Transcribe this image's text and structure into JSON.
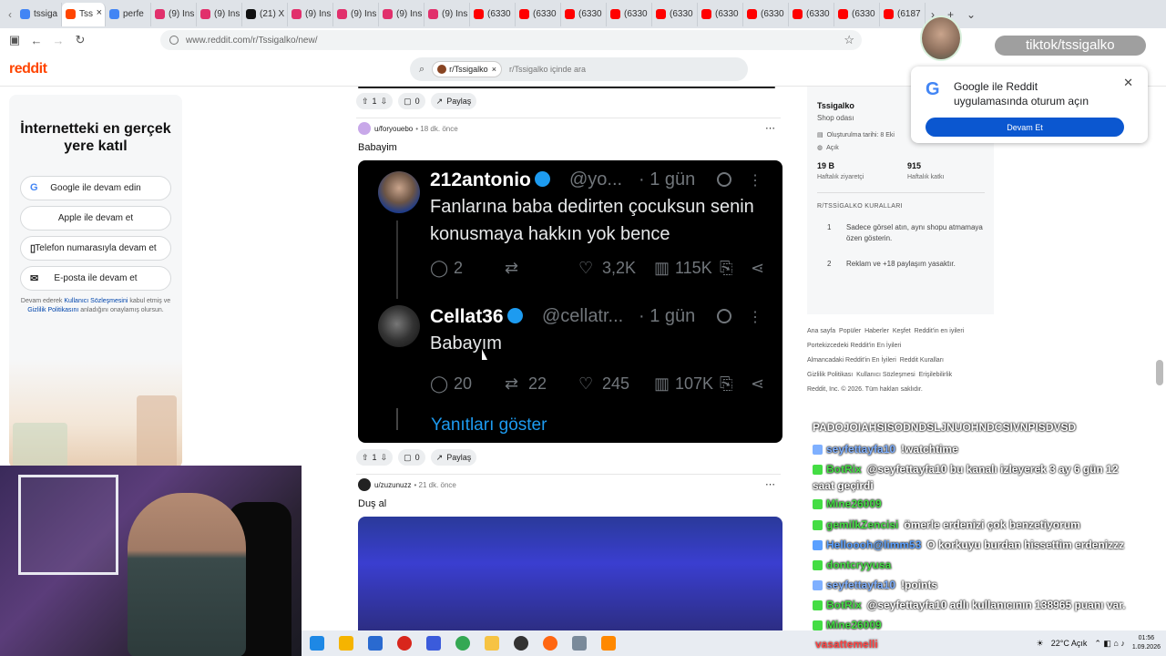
{
  "browser": {
    "tabs": [
      {
        "label": "tssiga",
        "color": "#4285f4"
      },
      {
        "label": "Tss",
        "color": "#ff4500",
        "active": true
      },
      {
        "label": "perfe",
        "color": "#4285f4"
      },
      {
        "label": "(9) Ins",
        "color": "#e1306c"
      },
      {
        "label": "(9) Ins",
        "color": "#e1306c"
      },
      {
        "label": "(21) X",
        "color": "#111111"
      },
      {
        "label": "(9) Ins",
        "color": "#e1306c"
      },
      {
        "label": "(9) Ins",
        "color": "#e1306c"
      },
      {
        "label": "(9) Ins",
        "color": "#e1306c"
      },
      {
        "label": "(9) Ins",
        "color": "#e1306c"
      },
      {
        "label": "(6330",
        "color": "#ff0000"
      },
      {
        "label": "(6330",
        "color": "#ff0000"
      },
      {
        "label": "(6330",
        "color": "#ff0000"
      },
      {
        "label": "(6330",
        "color": "#ff0000"
      },
      {
        "label": "(6330",
        "color": "#ff0000"
      },
      {
        "label": "(6330",
        "color": "#ff0000"
      },
      {
        "label": "(6330",
        "color": "#ff0000"
      },
      {
        "label": "(6330",
        "color": "#ff0000"
      },
      {
        "label": "(6330",
        "color": "#ff0000"
      },
      {
        "label": "(6187",
        "color": "#ff0000"
      }
    ],
    "url": "www.reddit.com/r/Tssigalko/new/"
  },
  "header": {
    "logo": "reddit",
    "search_chip": "r/Tssigalko",
    "search_placeholder": "r/Tssigalko içinde ara"
  },
  "login_panel": {
    "title": "İnternetteki en gerçek yere katıl",
    "buttons": [
      {
        "label": "Google ile devam edin",
        "icon": "G"
      },
      {
        "label": "Apple ile devam et",
        "icon": "apple"
      },
      {
        "label": "Telefon numarasıyla devam et",
        "icon": "phone"
      },
      {
        "label": "E-posta ile devam et",
        "icon": "mail"
      }
    ],
    "legal_pre": "Devam ederek ",
    "legal_link1": "Kullanıcı Sözleşmesini",
    "legal_mid": " kabul etmiş ve ",
    "legal_link2": "Gizlilik Politikasını",
    "legal_post": " anladığını onaylamış olursun."
  },
  "feed": {
    "prev_actions": {
      "votes": "1",
      "comments": "0",
      "share": "Paylaş"
    },
    "post1": {
      "author": "u/foryouebo",
      "time": "18 dk. önce",
      "title": "Babayim",
      "actions": {
        "votes": "1",
        "comments": "0",
        "share": "Paylaş"
      },
      "tweet1": {
        "name": "212antonio",
        "handle": "@yo...",
        "time": "· 1 gün",
        "text": "Fanlarına baba dedirten çocuksun senin konusmaya hakkın yok bence",
        "replies": "2",
        "likes": "3,2K",
        "views": "115K"
      },
      "tweet2": {
        "name": "Cellat36",
        "handle": "@cellatr...",
        "time": "· 1 gün",
        "text": "Babayım",
        "replies": "20",
        "retweets": "22",
        "likes": "245",
        "views": "107K"
      },
      "show_replies": "Yanıtları göster"
    },
    "post2": {
      "author": "u/zuzunuzz",
      "time": "21 dk. önce",
      "title": "Duş al"
    }
  },
  "community": {
    "name": "Tssigalko",
    "subtitle": "Shop odası",
    "created": "Oluşturulma tarihi: 8 Eki",
    "visibility": "Açık",
    "weekly_visitors": "19 B",
    "weekly_visitors_label": "Haftalık ziyaretçi",
    "weekly_contrib": "915",
    "weekly_contrib_label": "Haftalık katkı",
    "rules_header": "R/TSSİGALKO KURALLARI",
    "rules": [
      {
        "num": "1",
        "text": "Sadece görsel atın, aynı shopu atmamaya özen gösterin."
      },
      {
        "num": "2",
        "text": "Reklam ve +18 paylaşım yasaktır."
      }
    ]
  },
  "footer": {
    "links": [
      "Ana sayfa",
      "Popüler",
      "Haberler",
      "Keşfet",
      "Reddit'in en iyileri",
      "Portekizcedeki Reddit'in En İyileri",
      "Almancadaki Reddit'in En İyileri",
      "Reddit Kuralları",
      "Gizlilik Politikası",
      "Kullanıcı Sözleşmesi",
      "Erişilebilirlik"
    ],
    "copyright": "Reddit, Inc. © 2026. Tüm hakları saklıdır."
  },
  "google_popup": {
    "text": "Google ile Reddit uygulamasında oturum açın",
    "button": "Devam Et"
  },
  "stream": {
    "tiktok": "tiktok/tssigalko",
    "chat": [
      {
        "user": "",
        "msg": "PADOJOIAHSISODNDSLJNUOHNDCSIVNPISDVSD",
        "color": "#ffffff"
      },
      {
        "user": "seyfettayfa10",
        "msg": "!watchtime",
        "color": "#7fb0ff"
      },
      {
        "user": "BotRix",
        "msg": "@seyfettayfa10 bu kanalı izleyerek 3 ay 6 gün 12",
        "color": "#44dd44"
      },
      {
        "user": "",
        "msg": "saat geçirdi",
        "color": "#ffffff"
      },
      {
        "user": "Mine26009",
        "msg": "",
        "color": "#44dd44"
      },
      {
        "user": "gemilkZencisi",
        "msg": "ömerle erdenizi çok benzetiyorum",
        "color": "#44dd44"
      },
      {
        "user": "Helloooh@limm53",
        "msg": "O korkuyu burdan hissettim erdenizzz",
        "color": "#5aa0ff"
      },
      {
        "user": "dontcryyusa",
        "msg": "",
        "color": "#44dd44"
      },
      {
        "user": "seyfettayfa10",
        "msg": "!points",
        "color": "#7fb0ff"
      },
      {
        "user": "BotRix",
        "msg": "@seyfettayfa10 adlı kullanıcının 138965 puanı var.",
        "color": "#44dd44"
      },
      {
        "user": "Mine26009",
        "msg": "",
        "color": "#44dd44"
      }
    ],
    "overlay_name": "vasattemelli"
  },
  "taskbar": {
    "weather": "22°C  Açık",
    "time": "01:56",
    "date": "1.09.2026"
  }
}
